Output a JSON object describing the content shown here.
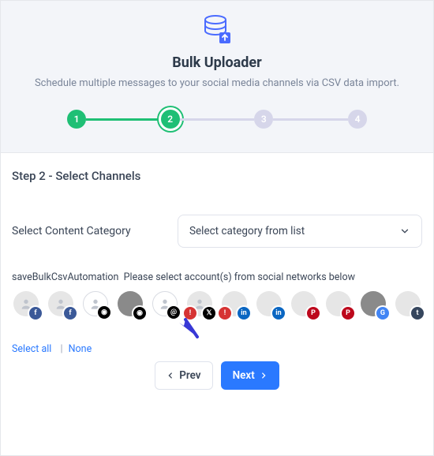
{
  "header": {
    "title": "Bulk Uploader",
    "subtitle": "Schedule multiple messages to your social media channels via CSV data import."
  },
  "steps": {
    "s1": "1",
    "s2": "2",
    "s3": "3",
    "s4": "4"
  },
  "body": {
    "heading": "Step 2 - Select Channels",
    "category_label": "Select Content Category",
    "category_placeholder": "Select category from list",
    "helper_key": "saveBulkCsvAutomation",
    "helper_text": "Please select account(s) from social networks below",
    "select_all": "Select all",
    "none": "None"
  },
  "badges": {
    "fb": "f",
    "ig": "◉",
    "threads": "@",
    "x": "𝕏",
    "li": "in",
    "pn": "P",
    "gb": "G",
    "tb": "t",
    "err": "!"
  },
  "nav": {
    "prev": "Prev",
    "next": "Next"
  },
  "colors": {
    "accent_green": "#1fbf75",
    "primary_blue": "#2a79ff",
    "error_red": "#d63333"
  }
}
